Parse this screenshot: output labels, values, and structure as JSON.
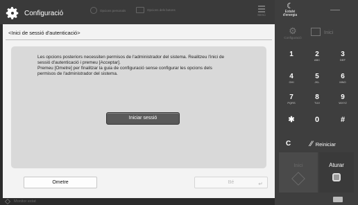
{
  "header": {
    "app_title": "Configuració",
    "slot1": "Opcions personals",
    "slot2": "Opcions dels botons",
    "menu_label": "Menú"
  },
  "right_panel": {
    "energy_label": "Estalvi d'energia",
    "settings_label": "Configuració",
    "home_label": "Inici",
    "keys": [
      {
        "main": "1",
        "sub": ""
      },
      {
        "main": "2",
        "sub": "ABC"
      },
      {
        "main": "3",
        "sub": "DEF"
      },
      {
        "main": "4",
        "sub": "GHI"
      },
      {
        "main": "5",
        "sub": "JKL"
      },
      {
        "main": "6",
        "sub": "MNO"
      },
      {
        "main": "7",
        "sub": "PQRS"
      },
      {
        "main": "8",
        "sub": "TUV"
      },
      {
        "main": "9",
        "sub": "WXYZ"
      },
      {
        "main": "✱",
        "sub": ""
      },
      {
        "main": "0",
        "sub": ""
      },
      {
        "main": "#",
        "sub": ""
      }
    ],
    "clear_label": "C",
    "reset_label": "Reiniciar",
    "start_label": "Inici",
    "stop_label": "Aturar"
  },
  "main": {
    "page_title": "<Inici de sessió d'autenticació>",
    "message_lines": [
      "Les opcions posteriors necessiten permisos de l'administrador del sistema. Realitzeu l'inici de",
      "sessió d'autenticació i premeu [Acceptar].",
      "Premeu [Ometre] per finalitzar la guia de configuració sense configurar les opcions dels",
      "permisos de l'administrador del sistema."
    ],
    "login_button": "Iniciar sessió",
    "omit_button": "Ometre",
    "ok_button": "Bé"
  },
  "status_bar": {
    "status_label": "Monitor estat"
  },
  "colors": {
    "frame": "#2b2b2b",
    "panel": "#f3f3f3",
    "card": "#d9d9d9",
    "primary_button": "#5a5a5a"
  }
}
